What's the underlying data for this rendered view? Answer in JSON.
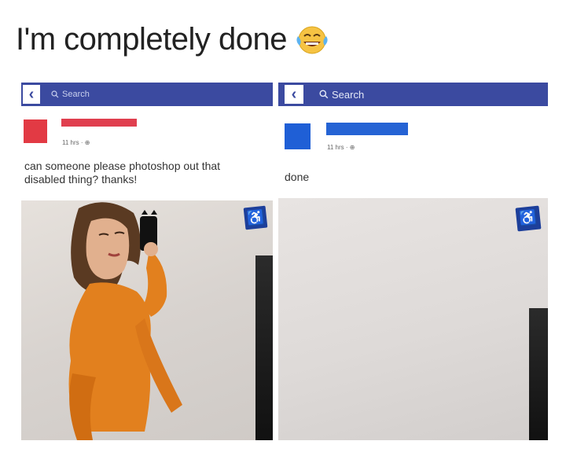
{
  "caption": {
    "text": "I'm completely done"
  },
  "left_post": {
    "search_label": "Search",
    "meta": "11 hrs · ⊕",
    "text": "can someone please photoshop out that disabled thing? thanks!"
  },
  "right_post": {
    "search_label": "Search",
    "meta": "11 hrs · ⊕",
    "text": "done"
  },
  "icons": {
    "emoji": "face-with-tears-of-joy",
    "back": "chevron-left",
    "search": "magnifier",
    "sign": "wheelchair-accessibility"
  },
  "colors": {
    "topbar": "#3b4aa0",
    "left_avatar": "#e23a44",
    "right_avatar": "#1f5fd6",
    "sign": "#1d3f9a",
    "dress": "#e2801e"
  }
}
